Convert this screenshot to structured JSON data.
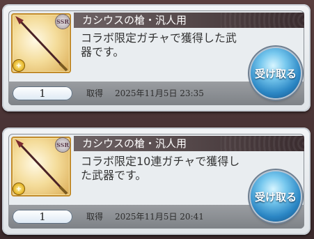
{
  "items": [
    {
      "title": "カシウスの槍・汎人用",
      "description": "コラボ限定ガチャで獲得した武器です。",
      "rarity": "SSR",
      "element_badge": "+",
      "quantity": "1",
      "acquired_label": "取得",
      "acquired_date": "2025年11月5日 23:35",
      "receive_label": "受け取る"
    },
    {
      "title": "カシウスの槍・汎人用",
      "description": "コラボ限定10連ガチャで獲得した武器です。",
      "rarity": "SSR",
      "element_badge": "+",
      "quantity": "1",
      "acquired_label": "取得",
      "acquired_date": "2025年11月5日 20:41",
      "receive_label": "受け取る"
    }
  ]
}
